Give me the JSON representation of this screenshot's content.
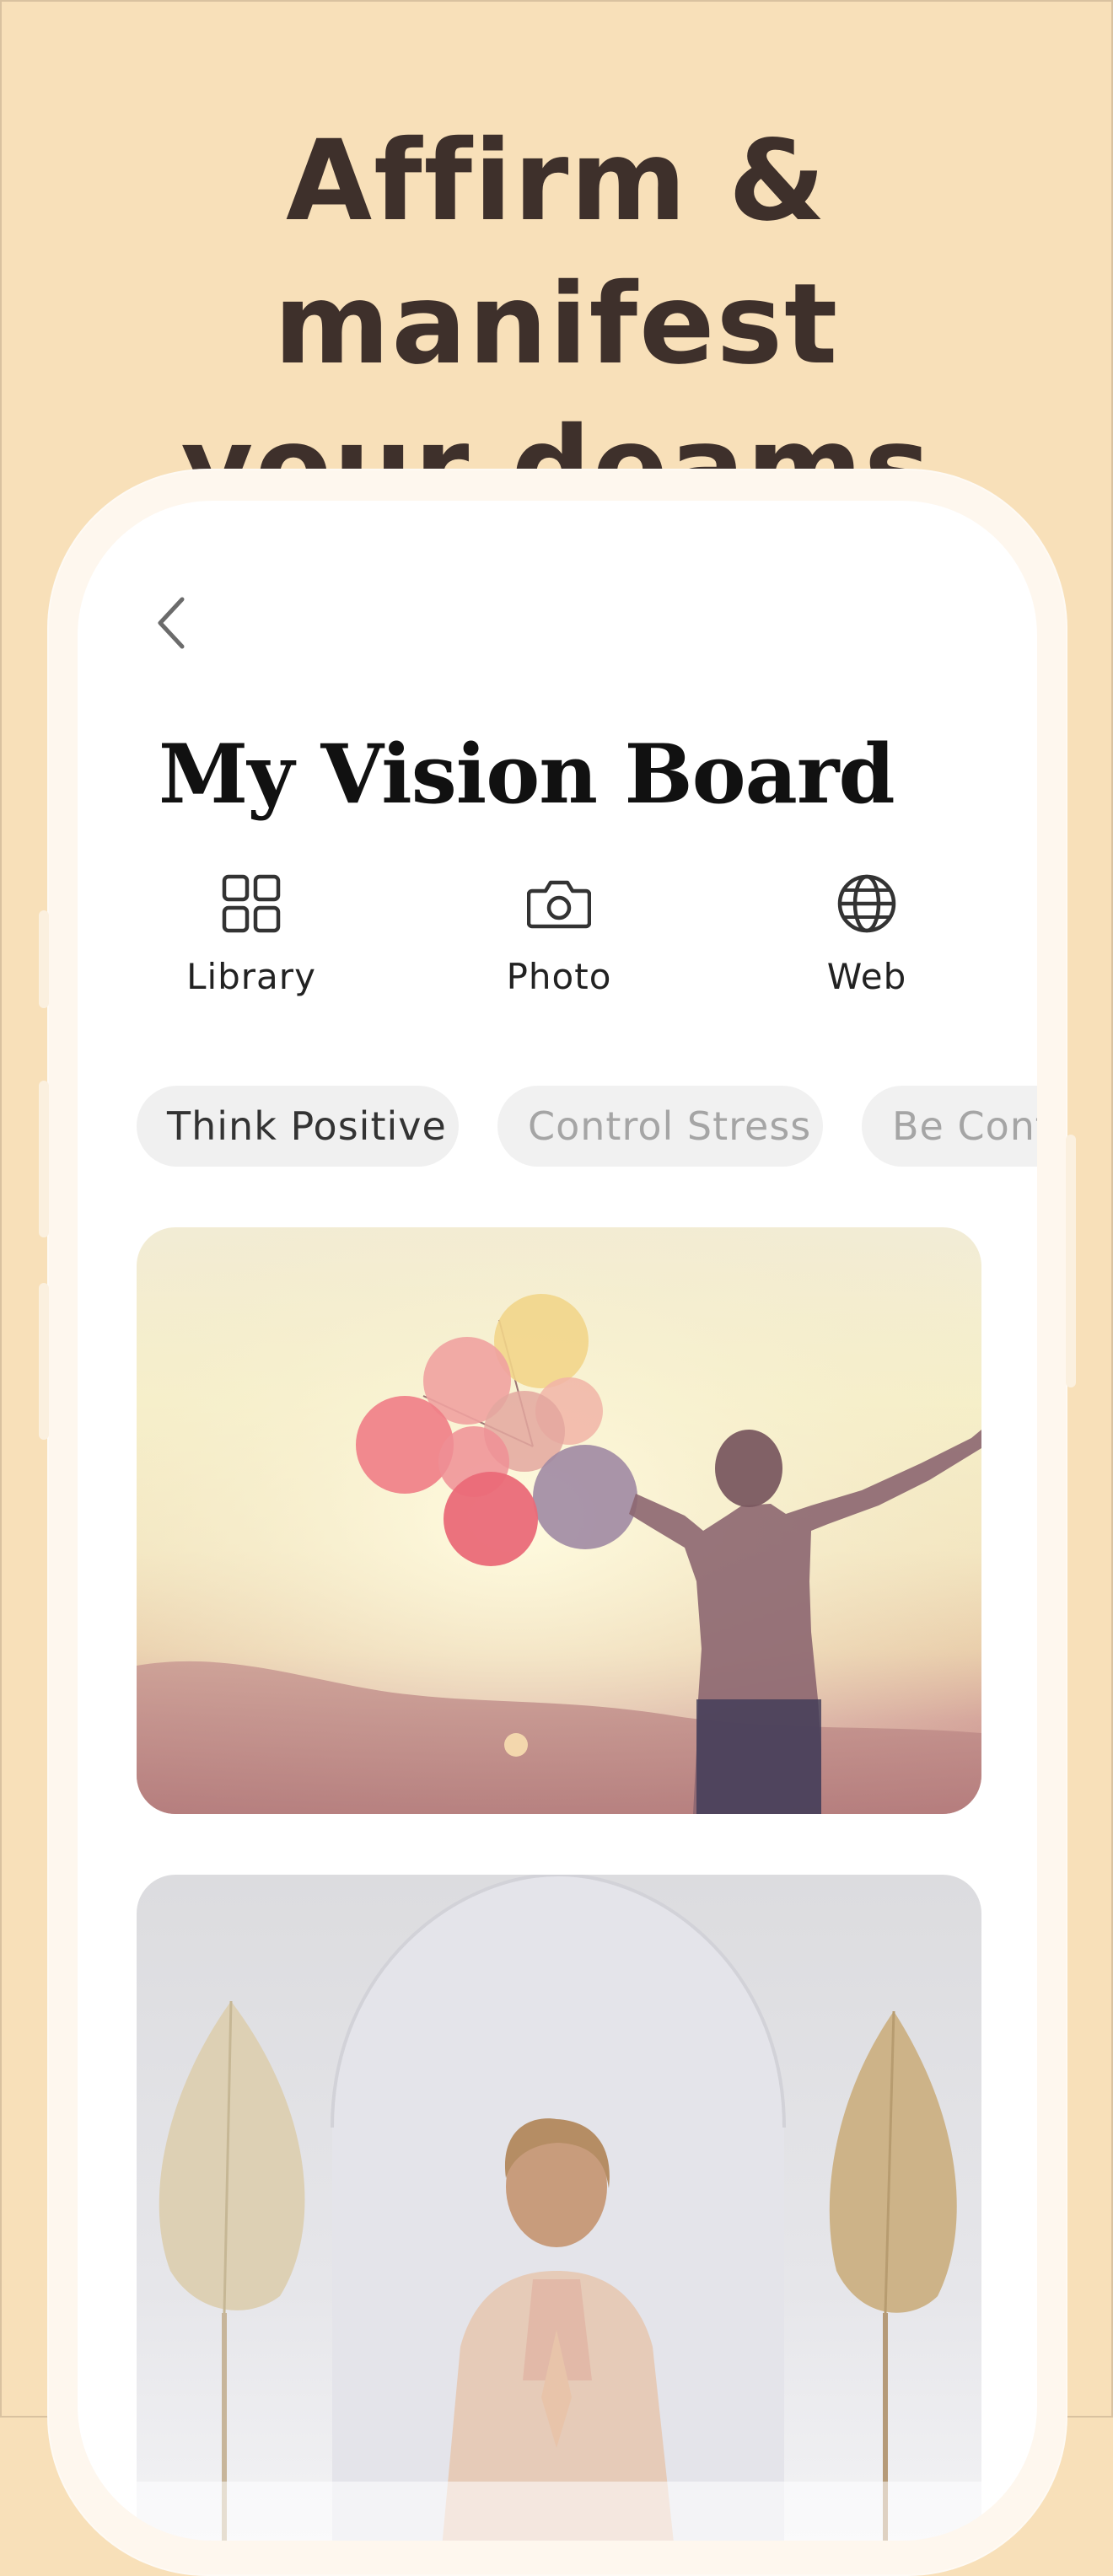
{
  "headline": {
    "line1": "Affirm & manifest",
    "line2": "your deams"
  },
  "colors": {
    "background": "#F8E0B9",
    "headline": "#3E302B",
    "phone_bezel": "#FEF7EE",
    "chip_bg": "#F0F0F0"
  },
  "screen": {
    "back_icon": "chevron-left-icon",
    "title": "My Vision Board",
    "actions": [
      {
        "label": "Library",
        "icon": "grid-icon"
      },
      {
        "label": "Photo",
        "icon": "camera-icon"
      },
      {
        "label": "Web",
        "icon": "globe-icon"
      }
    ],
    "chips": [
      {
        "label": "Think Positive",
        "selected": true
      },
      {
        "label": "Control Stress",
        "selected": false
      },
      {
        "label": "Be Conf",
        "selected": false
      }
    ],
    "images": [
      {
        "depicts": "balloons-woman-sunset"
      },
      {
        "depicts": "meditation-woman-arch"
      }
    ]
  }
}
